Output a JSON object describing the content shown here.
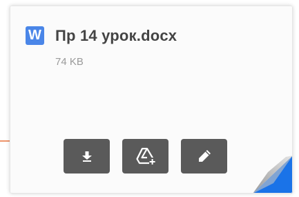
{
  "file": {
    "type_icon": "word-icon",
    "type_letter": "W",
    "name": "Пр 14 урок.docx",
    "size": "74 KB"
  },
  "actions": [
    {
      "id": "download",
      "icon": "download-icon"
    },
    {
      "id": "save-to-drive",
      "icon": "drive-add-icon"
    },
    {
      "id": "edit",
      "icon": "pencil-icon"
    }
  ],
  "colors": {
    "word_blue": "#4a86e8",
    "button_gray": "#5a5a5a",
    "arrow_orange": "#e8703a",
    "fold_blue": "#1a73e8"
  }
}
